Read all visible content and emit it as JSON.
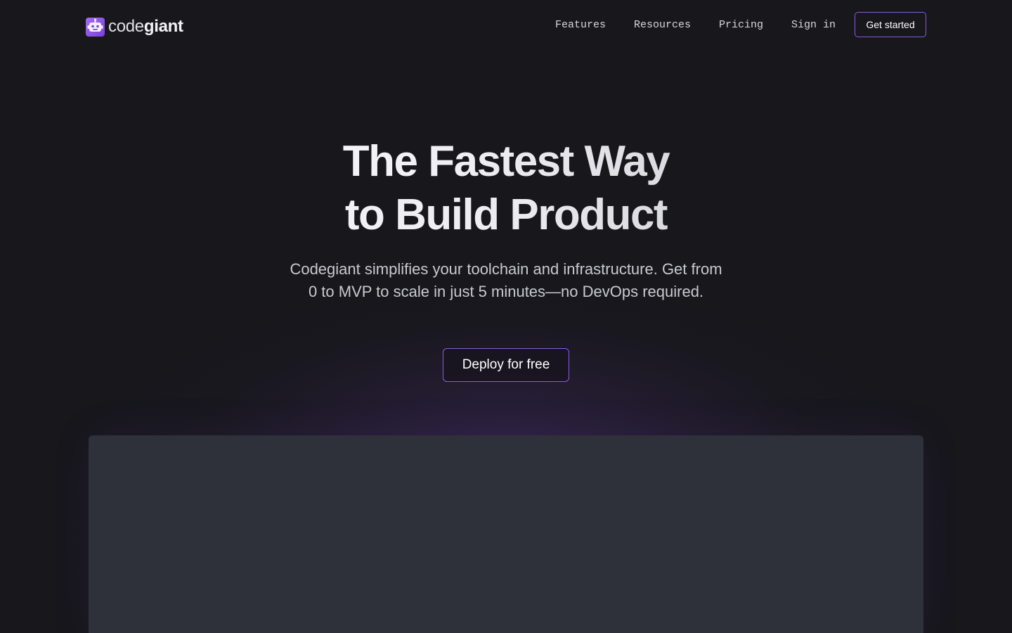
{
  "brand": {
    "name_light": "code",
    "name_bold": "giant",
    "icon": "robot-logo-icon",
    "accent_color": "#8a5cdb"
  },
  "nav": {
    "links": [
      {
        "label": "Features"
      },
      {
        "label": "Resources"
      },
      {
        "label": "Pricing"
      },
      {
        "label": "Sign in"
      }
    ],
    "cta_label": "Get started"
  },
  "hero": {
    "title_line1": "The Fastest Way",
    "title_line2": "to Build Product",
    "subtitle": "Codegiant simplifies your toolchain and infrastructure. Get from 0 to MVP to scale in just 5 minutes—no DevOps required.",
    "cta_label": "Deploy for free"
  },
  "colors": {
    "background": "#17171c",
    "panel": "#2e313a"
  }
}
